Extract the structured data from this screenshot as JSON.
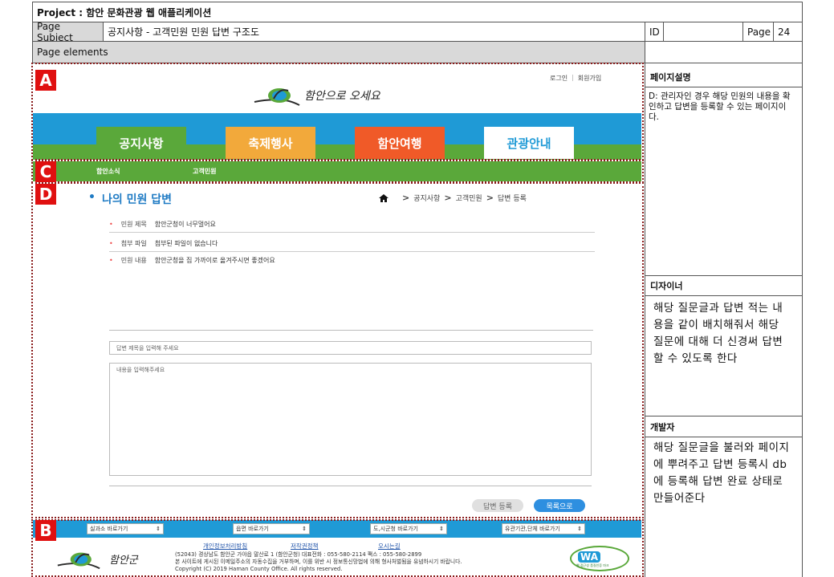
{
  "header": {
    "project": "Project : 함안 문화관광 웹 애플리케이션",
    "page_subject_label": "Page Subject",
    "page_subject": "공지사항 - 고객민원 민원 답변 구조도",
    "id_label": "ID",
    "id_value": "",
    "page_label": "Page",
    "page_number": "24",
    "elements_label": "Page elements"
  },
  "badges": {
    "a": "A",
    "b": "B",
    "c": "C",
    "d": "D"
  },
  "site": {
    "top_links": {
      "login": "로그인",
      "separator": "|",
      "join": "회원가입"
    },
    "logo_text": "함안으로 오세요",
    "nav_tabs": [
      "공지사항",
      "축제행사",
      "함안여행",
      "관광안내"
    ],
    "colors": {
      "nav_bg": "#1f9ad6",
      "tab1": "#5aa83a",
      "tab2": "#f2a93b",
      "tab3": "#f05a28",
      "tab4": "#ffffff",
      "subnav": "#5aa83a",
      "tab4_text": "#1f9ad6"
    },
    "subnav": [
      "함안소식",
      "고객민원"
    ],
    "page_title_bullet": "•",
    "page_title": "나의 민원 답변",
    "breadcrumb": {
      "home_icon": "home-icon",
      "items": [
        "공지사항",
        "고객민원",
        "답변 등록"
      ],
      "sep": ">"
    },
    "rows": [
      {
        "label": "민원 제목",
        "value": "함안군청이 너무멀어요"
      },
      {
        "label": "첨부 파일",
        "value": "첨부된 파일이 없습니다"
      },
      {
        "label": "민원 내용",
        "value": "함안군청을 집 가까이로 옮겨주시면 좋겠어요"
      }
    ],
    "answer_title_placeholder": "답변 제목을 입력해 주세요",
    "answer_content_placeholder": "내용을 입력해주세요",
    "buttons": {
      "register": "답변 등록",
      "list": "목록으로"
    },
    "footer_selects": [
      "실과소 바로가기",
      "읍면 바로가기",
      "도,시군청 바로가기",
      "유관기관,단체 바로가기"
    ],
    "footer_links": [
      "개인정보처리방침",
      "저작권정책",
      "오시는길"
    ],
    "footer_address": "(52043) 경상남도 함안군 가야읍 말산로 1 (함안군청)   대표전화 : 055-580-2114    팩스 : 055-580-2899",
    "footer_notice": "본 사이트에 게시된 이메일주소의 자동수집을 거부하며, 이를 위반 시 정보통신망법에 의해 형사처벌됨을 유념하시기 바랍니다.",
    "footer_copyright": "Copyright (C) 2019 Haman County Office. All rights reserved.",
    "footer_logo_text": "함안군",
    "wa_mark": "WA",
    "wa_caption": "웹 접근성 품질인증 마크"
  },
  "side": {
    "desc_title": "페이지설명",
    "desc_text": "D: 관리자인 경우 해당 민원의 내용을 확인하고 답변을 등록할 수 있는 페이지이다.",
    "designer_title": "디자이너",
    "designer_text": "해당 질문글과 답변 적는 내용을 같이 배치해줘서 해당 질문에 대해 더 신경써 답변할 수 있도록 한다",
    "developer_title": "개발자",
    "developer_text": "해당 질문글을 불러와 페이지에 뿌려주고 답변 등록시 db에 등록해 답변 완료 상태로 만들어준다"
  }
}
